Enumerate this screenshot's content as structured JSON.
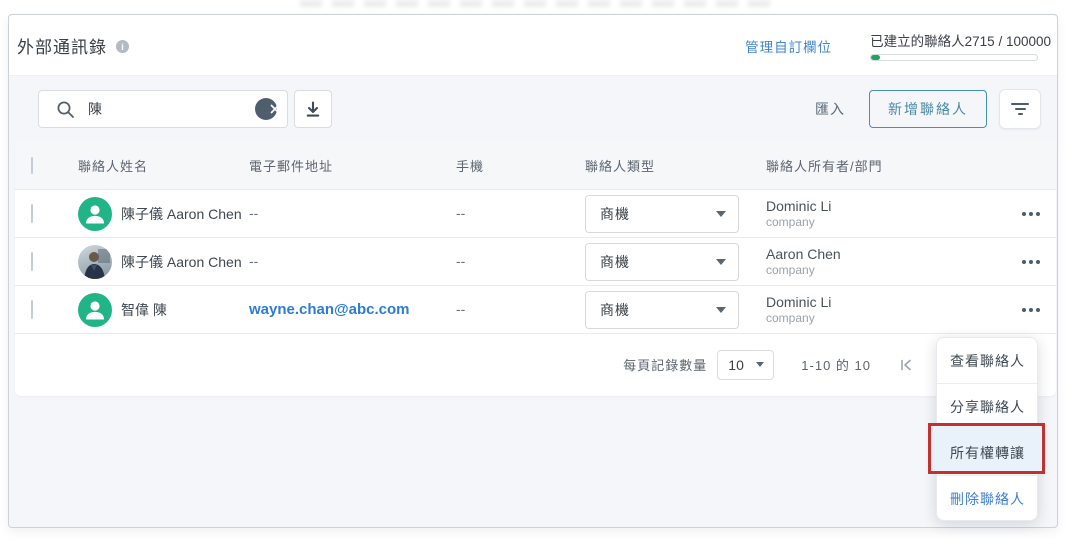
{
  "header": {
    "title": "外部通訊錄",
    "manage_custom_fields": "管理自訂欄位",
    "created_contacts": "已建立的聯絡人2715 / 100000"
  },
  "toolbar": {
    "search_value": "陳",
    "import_label": "匯入",
    "add_contact_label": "新增聯絡人"
  },
  "table": {
    "headers": {
      "name": "聯絡人姓名",
      "email": "電子郵件地址",
      "mobile": "手機",
      "type": "聯絡人類型",
      "owner": "聯絡人所有者/部門"
    },
    "rows": [
      {
        "name": "陳子儀 Aaron Chen",
        "email": "--",
        "mobile": "--",
        "type": "商機",
        "owner": "Dominic Li",
        "department": "company",
        "avatar": "person-icon"
      },
      {
        "name": "陳子儀 Aaron Chen",
        "email": "--",
        "mobile": "--",
        "type": "商機",
        "owner": "Aaron Chen",
        "department": "company",
        "avatar": "photo"
      },
      {
        "name": "智偉 陳",
        "email": "wayne.chan@abc.com",
        "mobile": "--",
        "type": "商機",
        "owner": "Dominic Li",
        "department": "company",
        "avatar": "person-icon"
      }
    ]
  },
  "pagination": {
    "per_page_label": "每頁記錄數量",
    "per_page_value": "10",
    "range_label": "1-10 的 10"
  },
  "context_menu": {
    "items": [
      "查看聯絡人",
      "分享聯絡人",
      "所有權轉讓",
      "刪除聯絡人"
    ],
    "highlighted_item": "所有權轉讓"
  },
  "colors": {
    "avatar_green": "#20b486",
    "email_link_blue": "#2b7cd9",
    "delete_action_blue": "#3d7fd0",
    "add_button_teal": "#4392b2",
    "highlight_red": "#c0312f",
    "highlight_bg": "#e9f2fb",
    "progress_green": "#1fa561"
  }
}
